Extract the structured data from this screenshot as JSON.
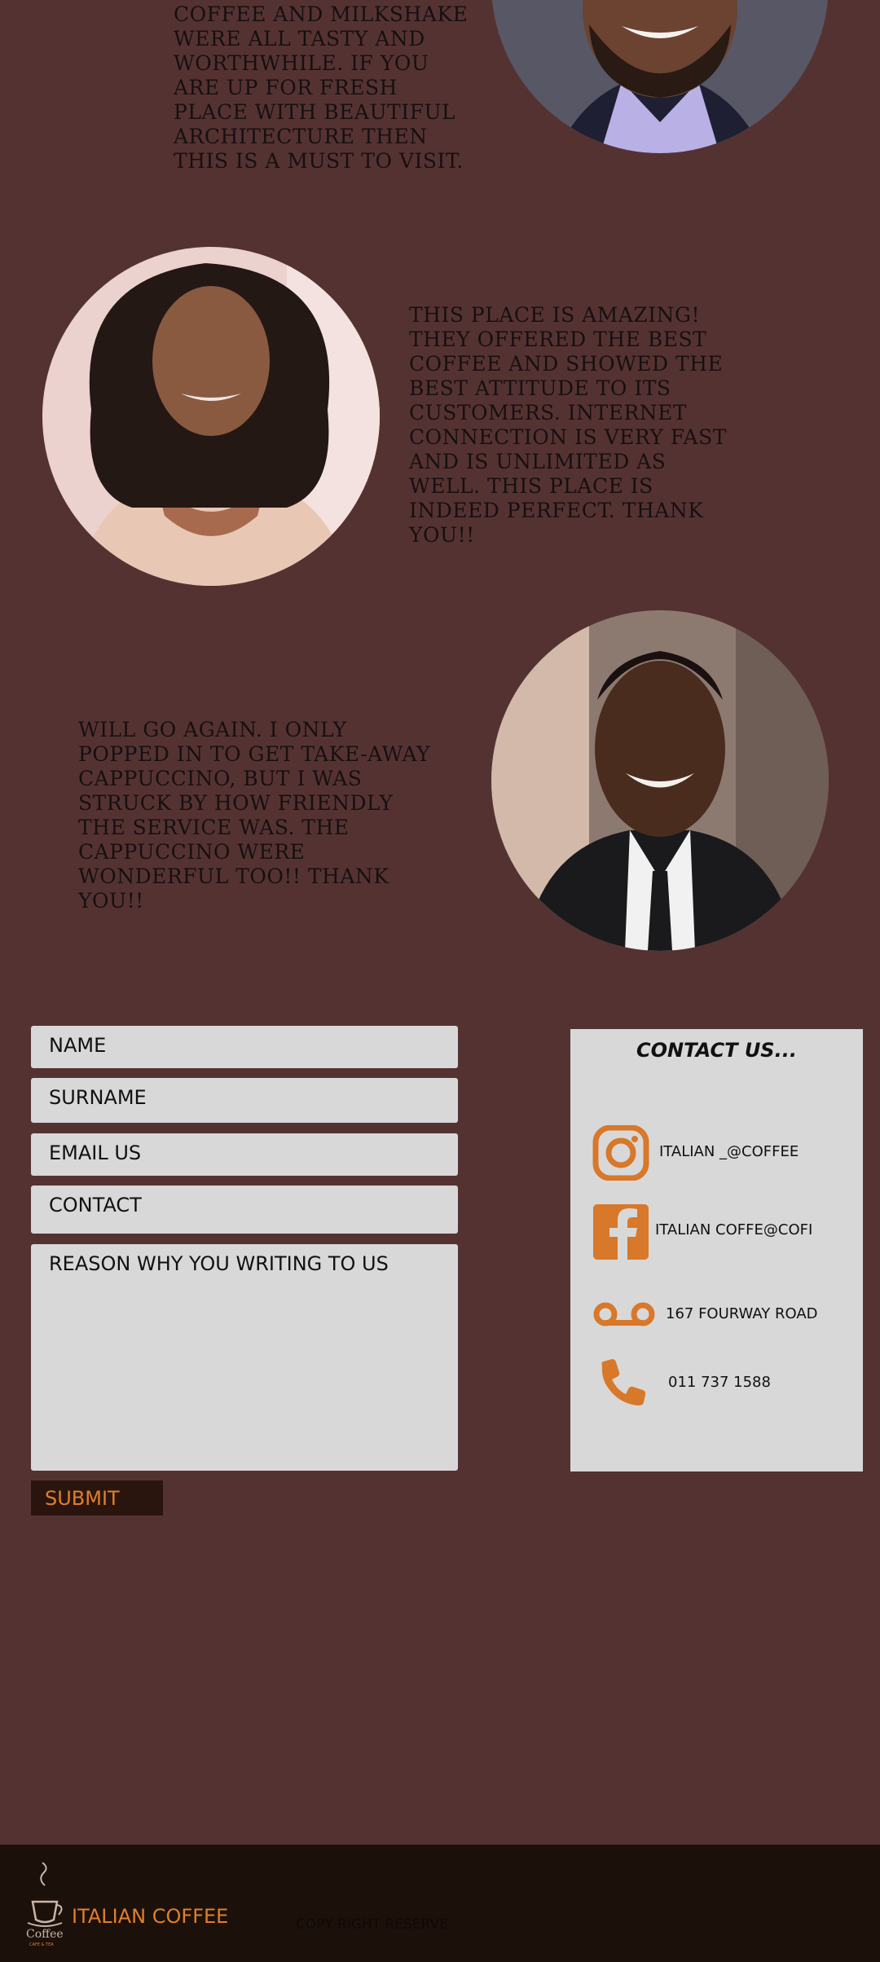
{
  "reviews": [
    {
      "text": "Coffee and milkshake were all tasty and worthwhile. If you are up for fresh place with beautiful architecture then this is a must to visit."
    },
    {
      "text": "This place is amazing! They offered the best coffee and showed the best attitude to its customers. Internet connection is very fast and is unlimited as well. This place is indeed perfect. Thank you!!"
    },
    {
      "text": "Will go again. I only popped in to get take-away cappuccino, but I was struck by how friendly the service was. The cappuccino were wonderful too!! Thank you!!"
    }
  ],
  "form": {
    "name": "NAME",
    "surname": "SURNAME",
    "email": "EMAIL US",
    "contact": "CONTACT",
    "reason": "REASON WHY YOU WRITING TO US",
    "submit": "SUBMIT"
  },
  "contact_card": {
    "title": "CONTACT US...",
    "items": [
      {
        "icon": "instagram-icon",
        "label": "ITALIAN _@COFFEE"
      },
      {
        "icon": "facebook-icon",
        "label": "ITALIAN COFFE@COFI"
      },
      {
        "icon": "voicemail-icon",
        "label": "167 FOURWAY ROAD"
      },
      {
        "icon": "phone-icon",
        "label": "011 737 1588"
      }
    ],
    "accent": "#d8782a"
  },
  "footer": {
    "logo_text": "Coffee",
    "logo_subtext": "CAFE & TEA",
    "brand": "ITALIAN COFFEE",
    "copyright": "COPY RIGHT RESERVE"
  },
  "colors": {
    "background": "#553232",
    "footer": "#1c100b",
    "accent": "#e07f2a"
  }
}
